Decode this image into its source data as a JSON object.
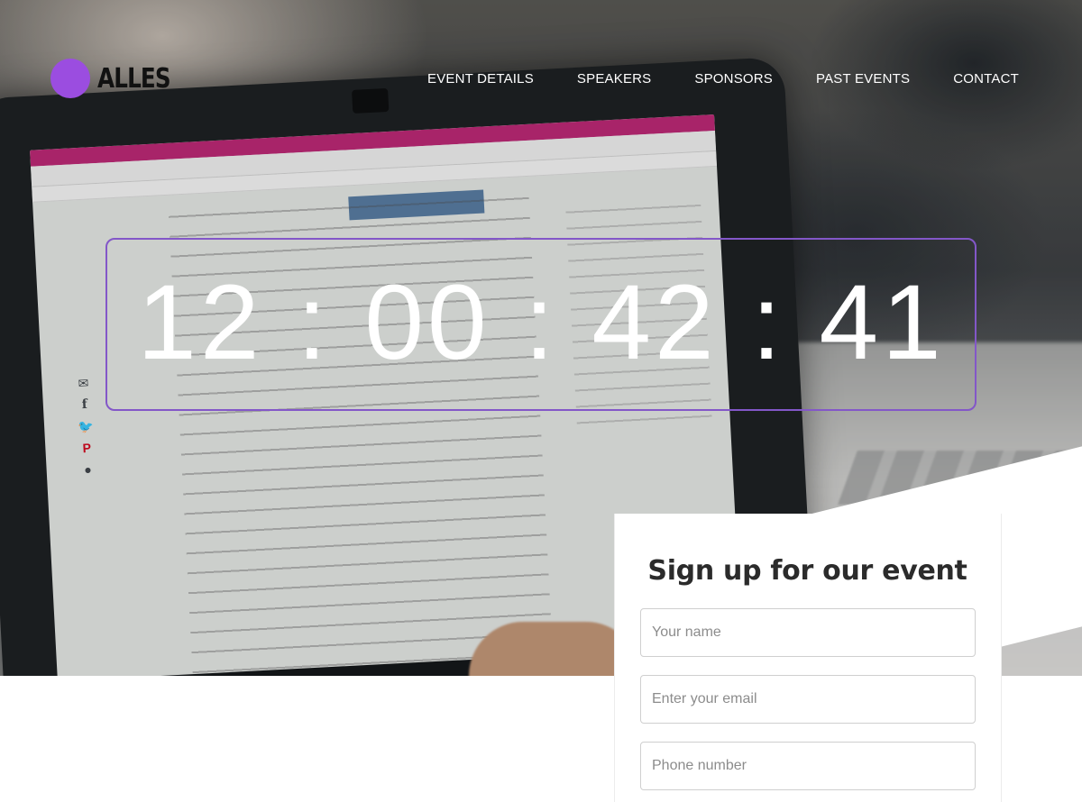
{
  "brand": {
    "name": "ALLES",
    "accent": "#9b4de0"
  },
  "nav": {
    "items": [
      {
        "label": "EVENT DETAILS"
      },
      {
        "label": "SPEAKERS"
      },
      {
        "label": "SPONSORS"
      },
      {
        "label": "PAST EVENTS"
      },
      {
        "label": "CONTACT"
      }
    ]
  },
  "countdown": {
    "days": "12",
    "hours": "00",
    "minutes": "42",
    "seconds": "41",
    "separator": ":",
    "border_color": "#8357c8"
  },
  "share": {
    "icons": [
      "mail-icon",
      "facebook-icon",
      "twitter-icon",
      "pinterest-icon",
      "reddit-icon"
    ]
  },
  "signup": {
    "title": "Sign up for our event",
    "name_placeholder": "Your name",
    "email_placeholder": "Enter your email",
    "phone_placeholder": "Phone number"
  }
}
